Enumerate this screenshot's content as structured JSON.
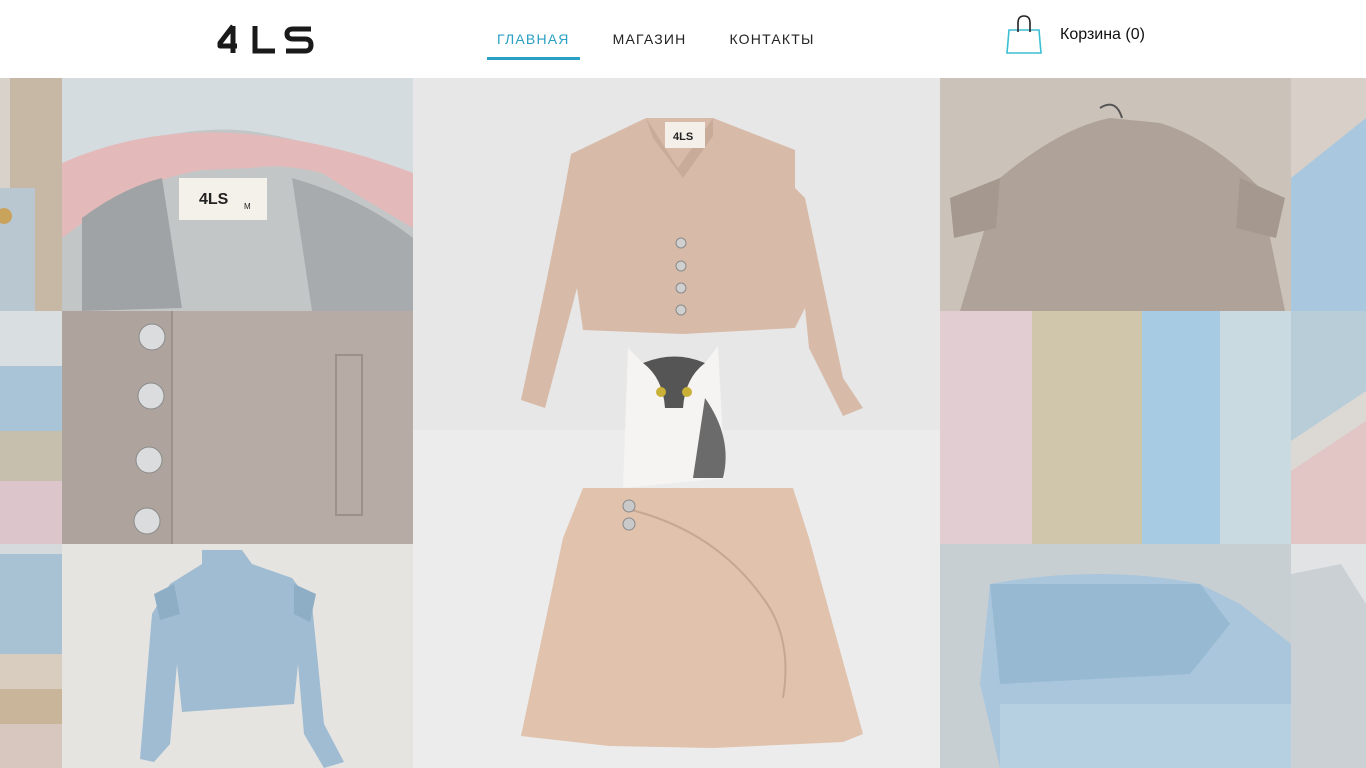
{
  "header": {
    "logo_text": "4LS",
    "nav": [
      {
        "label": "ГЛАВНАЯ",
        "active": true
      },
      {
        "label": "МАГАЗИН",
        "active": false
      },
      {
        "label": "КОНТАКТЫ",
        "active": false
      }
    ],
    "cart_label": "Корзина (0)",
    "accent_color": "#2aa0c4"
  },
  "gallery": {
    "jacket_label_text": "4LS",
    "jacket_label_size": "M",
    "center_label_text": "4LS"
  },
  "icons": {
    "cart": "shopping-bag-icon"
  }
}
